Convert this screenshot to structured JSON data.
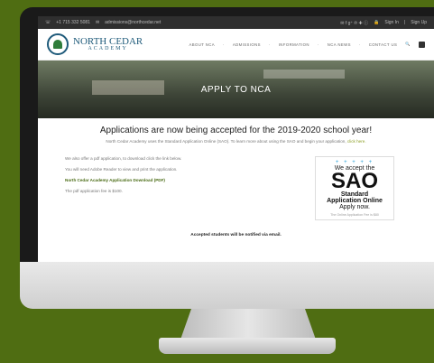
{
  "topbar": {
    "phone": "+1 715 332 5081",
    "email": "admissions@northcedar.net",
    "social": "✉ f g⁺ ℗ ✚ ⓘ",
    "sign_in": "Sign In",
    "sign_up": "Sign Up"
  },
  "logo": {
    "title": "NORTH CEDAR",
    "subtitle": "ACADEMY"
  },
  "nav": {
    "items": [
      "ABOUT NCA",
      "ADMISSIONS",
      "INFORMATION",
      "NCA NEWS",
      "CONTACT US"
    ]
  },
  "hero": {
    "title": "APPLY TO NCA"
  },
  "main": {
    "headline": "Applications are now being accepted for the 2019-2020 school year!",
    "subline": "North Cedar Academy uses the Standard Application Online (SAO). To learn more about using the SAO and begin your application,",
    "subline_link": "click here.",
    "p1": "We also offer a pdf application, to download click the link below.",
    "p2": "You will need Adobe Reader to view and print the application.",
    "download_link": "North Cedar Academy Application Download (PDF)",
    "fee": "The pdf application fee is $100.",
    "notify": "Accepted students will be notified via email."
  },
  "sao": {
    "accept": "We accept the",
    "big": "SAO",
    "standard": "Standard",
    "online": "Application Online",
    "apply": "Apply now.",
    "fee": "The Online Application Fee is $80"
  }
}
